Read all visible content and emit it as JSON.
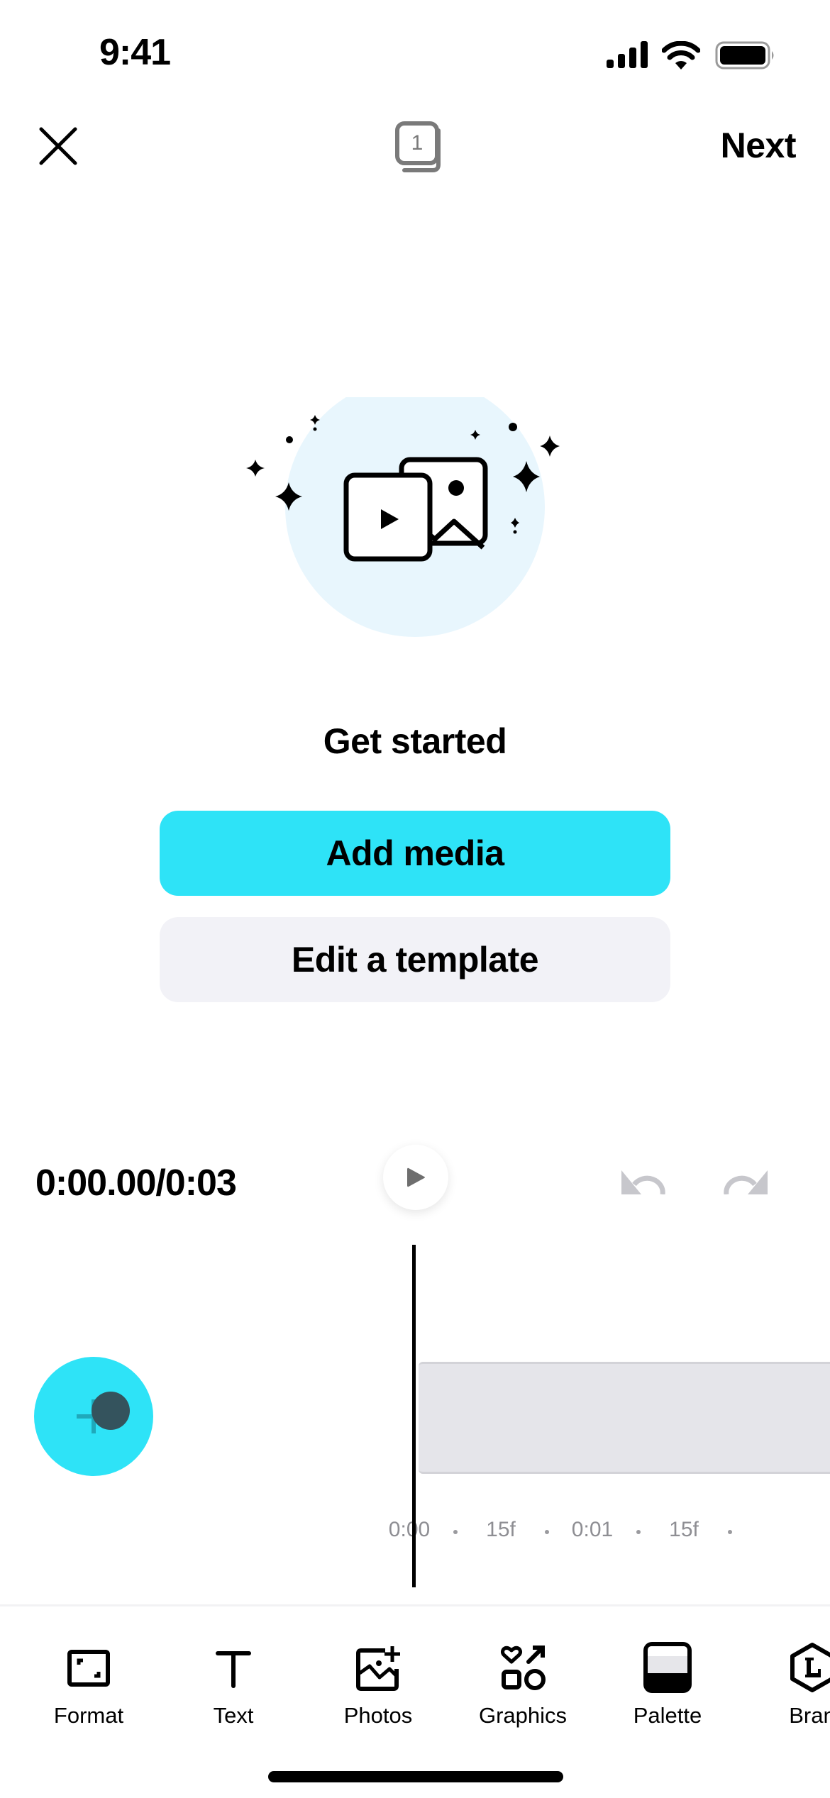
{
  "status_bar": {
    "time": "9:41",
    "icons": [
      "cellular-signal-icon",
      "wifi-icon",
      "battery-icon"
    ]
  },
  "nav": {
    "close_icon": "close-icon",
    "pages_icon": "pages-stack-icon",
    "page_count": "1",
    "next_label": "Next"
  },
  "empty_state": {
    "illustration": "media-sparkles-illustration",
    "title": "Get started",
    "primary_button": "Add media",
    "secondary_button": "Edit a template"
  },
  "transport": {
    "timecode": "0:00.00/0:03",
    "play_icon": "play-icon",
    "undo_icon": "undo-icon",
    "redo_icon": "redo-icon"
  },
  "timeline": {
    "add_button_icon": "plus-icon",
    "ruler": [
      {
        "type": "label",
        "text": "0:00"
      },
      {
        "type": "dot"
      },
      {
        "type": "label",
        "text": "15f"
      },
      {
        "type": "dot"
      },
      {
        "type": "label",
        "text": "0:01"
      },
      {
        "type": "dot"
      },
      {
        "type": "label",
        "text": "15f"
      },
      {
        "type": "dot"
      }
    ]
  },
  "toolbar": {
    "items": [
      {
        "label": "Format",
        "icon": "format-icon"
      },
      {
        "label": "Text",
        "icon": "text-icon"
      },
      {
        "label": "Photos",
        "icon": "add-photo-icon"
      },
      {
        "label": "Graphics",
        "icon": "graphics-icon"
      },
      {
        "label": "Palette",
        "icon": "palette-icon"
      },
      {
        "label": "Bran",
        "icon": "brand-icon"
      }
    ]
  },
  "colors": {
    "accent": "#2ee3f7",
    "secondary_button": "#f2f2f7",
    "illustration_bg": "#e8f6fd",
    "clip_track": "#e5e5ea",
    "muted_text": "#8e8e93",
    "disabled_icon": "#c7c7cc"
  }
}
